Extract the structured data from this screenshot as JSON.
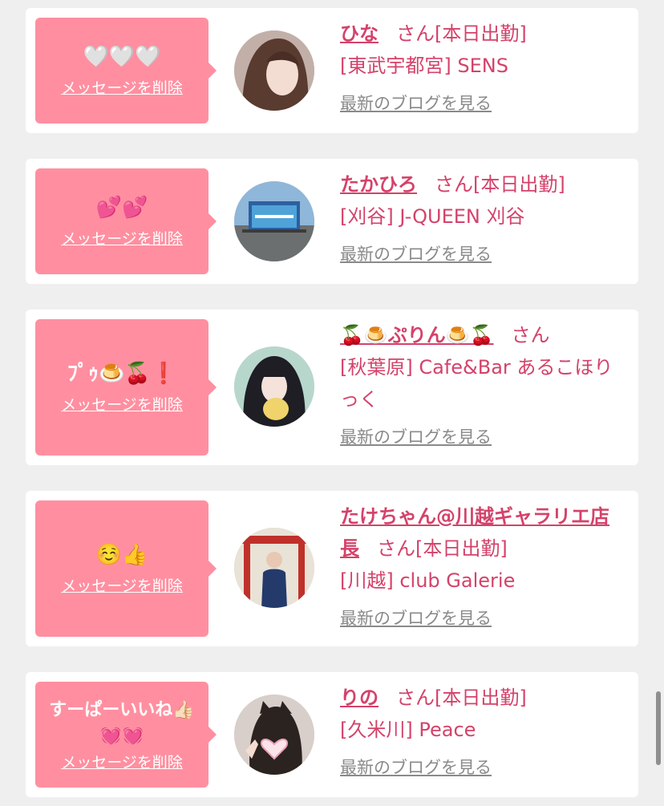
{
  "delete_label": "メッセージを削除",
  "blog_label": "最新のブログを見る",
  "san_label": "さん",
  "colors": {
    "background": "#efefef",
    "bubble": "#ff8fa0",
    "accent": "#d4426a",
    "blog_link": "#8a8a8a"
  },
  "items": [
    {
      "message": "🤍🤍🤍",
      "name": "ひな",
      "status": "[本日出勤]",
      "shop": "[東武宇都宮] SENS"
    },
    {
      "message": "💕💕",
      "name": "たかひろ",
      "status": "[本日出勤]",
      "shop": "[刈谷] J-QUEEN 刈谷"
    },
    {
      "message": "ﾌﾟｩ🍮🍒❗",
      "name": "🍒🍮ぷりん🍮🍒",
      "status": "",
      "shop": "[秋葉原] Cafe&Bar あるこほりっく"
    },
    {
      "message": "☺️👍",
      "name": "たけちゃん@川越ギャラリエ店長",
      "status": "[本日出勤]",
      "shop": "[川越] club Galerie"
    },
    {
      "message": "すーぱーいいね👍🏻💓💓",
      "name": "りの",
      "status": "[本日出勤]",
      "shop": "[久米川] Peace"
    }
  ]
}
